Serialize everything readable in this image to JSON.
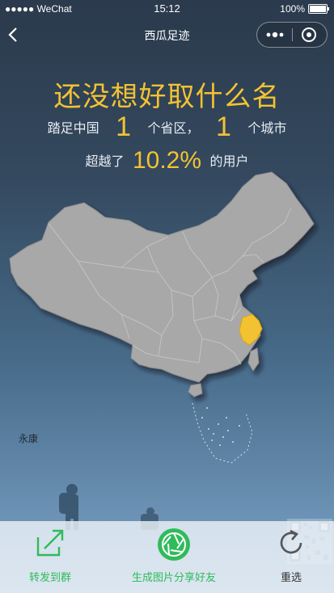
{
  "status_bar": {
    "carrier": "●●●●● WeChat",
    "time": "15:12",
    "battery": "100%"
  },
  "nav": {
    "title": "西瓜足迹"
  },
  "summary": {
    "headline": "还没想好取什么名",
    "visited_prefix": "踏足中国",
    "province_count": "1",
    "province_unit": "个省区，",
    "city_count": "1",
    "city_unit": "个城市",
    "beat_prefix": "超越了",
    "beat_percent": "10.2%",
    "beat_suffix": "的用户"
  },
  "map": {
    "highlighted_region": "Zhejiang",
    "highlight_color": "#f3c233",
    "base_color": "#a8a8a8"
  },
  "place_label": "永康",
  "actions": [
    {
      "label": "转发到群",
      "icon": "share-out-icon",
      "color": "#2fbb5b"
    },
    {
      "label": "生成图片分享好友",
      "icon": "aperture-icon",
      "color": "#2fbb5b"
    },
    {
      "label": "重选",
      "icon": "refresh-icon",
      "color": "#333333"
    }
  ]
}
